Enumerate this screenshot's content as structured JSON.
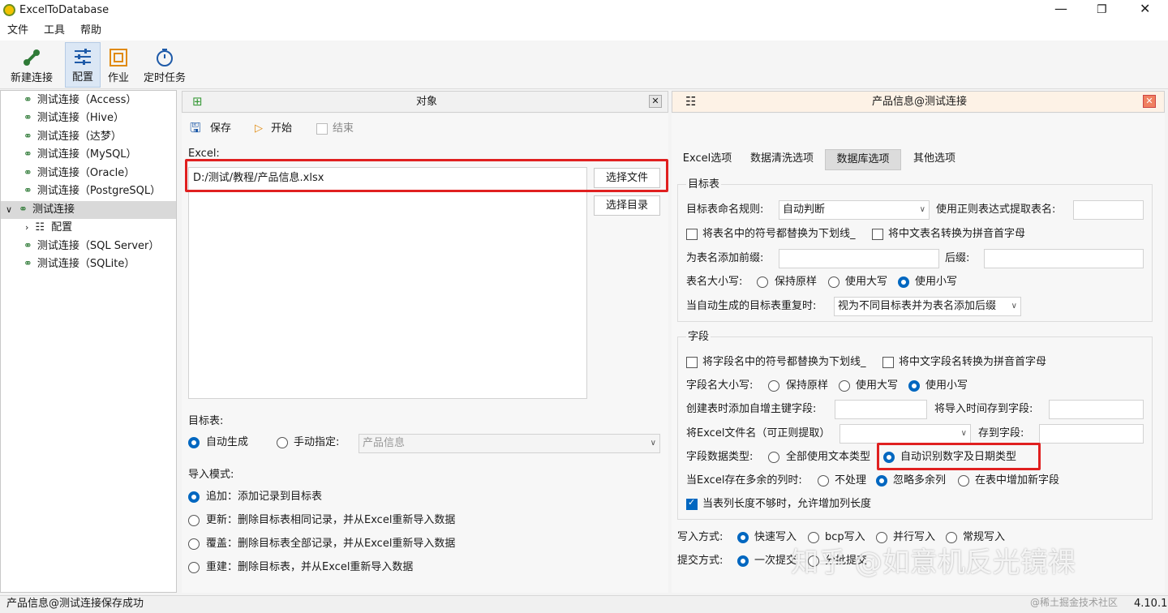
{
  "app": {
    "title": "ExcelToDatabase",
    "version": "4.10.1"
  },
  "menu": [
    "文件",
    "工具",
    "帮助"
  ],
  "toolbar": {
    "new_connection": "新建连接",
    "config": "配置",
    "job": "作业",
    "schedule": "定时任务"
  },
  "tree": {
    "items": [
      "测试连接（Access）",
      "测试连接（Hive）",
      "测试连接（达梦）",
      "测试连接（MySQL）",
      "测试连接（Oracle）",
      "测试连接（PostgreSQL）",
      "测试连接",
      "配置",
      "测试连接（SQL Server）",
      "测试连接（SQLite）"
    ]
  },
  "left_panel": {
    "title": "对象",
    "save": "保存",
    "start": "开始",
    "end": "结束",
    "excel_label": "Excel:",
    "excel_path": "D:/测试/教程/产品信息.xlsx",
    "choose_file": "选择文件",
    "choose_dir": "选择目录",
    "target_label": "目标表:",
    "auto_generate": "自动生成",
    "manual_specify": "手动指定:",
    "manual_value": "产品信息",
    "import_mode_label": "导入模式:",
    "modes": [
      "追加：添加记录到目标表",
      "更新：删除目标表相同记录，并从Excel重新导入数据",
      "覆盖：删除目标表全部记录，并从Excel重新导入数据",
      "重建：删除目标表，并从Excel重新导入数据"
    ]
  },
  "right_panel": {
    "title": "产品信息@测试连接",
    "tabs": [
      "Excel选项",
      "数据清洗选项",
      "数据库选项",
      "其他选项"
    ],
    "target": {
      "group": "目标表",
      "naming_label": "目标表命名规则:",
      "naming_value": "自动判断",
      "regex_label": "使用正则表达式提取表名:",
      "replace_symbols": "将表名中的符号都替换为下划线_",
      "pinyin": "将中文表名转换为拼音首字母",
      "prefix_label": "为表名添加前缀:",
      "suffix_label": "后缀:",
      "case_label": "表名大小写:",
      "case_keep": "保持原样",
      "case_upper": "使用大写",
      "case_lower": "使用小写",
      "dup_label": "当自动生成的目标表重复时:",
      "dup_value": "视为不同目标表并为表名添加后缀"
    },
    "field": {
      "group": "字段",
      "replace_symbols": "将字段名中的符号都替换为下划线_",
      "pinyin": "将中文字段名转换为拼音首字母",
      "case_label": "字段名大小写:",
      "case_keep": "保持原样",
      "case_upper": "使用大写",
      "case_lower": "使用小写",
      "pk_label": "创建表时添加自增主键字段:",
      "time_label": "将导入时间存到字段:",
      "filename_label": "将Excel文件名（可正则提取）",
      "store_label": "存到字段:",
      "type_label": "字段数据类型:",
      "type_text": "全部使用文本类型",
      "type_auto": "自动识别数字及日期类型",
      "extra_label": "当Excel存在多余的列时:",
      "extra_none": "不处理",
      "extra_ignore": "忽略多余列",
      "extra_add": "在表中增加新字段",
      "grow_label": "当表列长度不够时，允许增加列长度"
    },
    "write": {
      "label": "写入方式:",
      "fast": "快速写入",
      "bcp": "bcp写入",
      "parallel": "并行写入",
      "normal": "常规写入"
    },
    "commit": {
      "label": "提交方式:",
      "once": "一次提交",
      "batch": "分批提交"
    }
  },
  "status": "产品信息@测试连接保存成功",
  "watermark": {
    "text": "知乎 @如意机反光镜裸",
    "source": "@稀土掘金技术社区"
  },
  "colors": {
    "accent": "#0067c0",
    "highlight": "#e02020"
  }
}
